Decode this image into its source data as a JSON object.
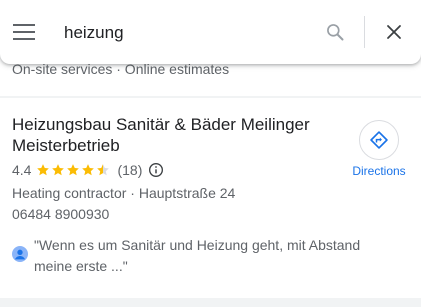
{
  "search": {
    "query": "heizung",
    "menu_icon": "menu-icon",
    "search_icon": "search-icon",
    "close_icon": "close-icon"
  },
  "previous_result": {
    "text": "On-site services · Online estimates"
  },
  "result": {
    "name": "Heizungsbau Sanitär & Bäder Meilinger Meisterbetrieb",
    "rating": 4.4,
    "rating_text": "4.4",
    "review_count": "(18)",
    "category_address": "Heating contractor · Hauptstraße 24",
    "phone": "06484 8900930",
    "directions_label": "Directions",
    "review_snippet": "\"Wenn es um Sanitär und Heizung geht, mit Abstand meine erste ...\""
  },
  "colors": {
    "accent": "#1a73e8",
    "star": "#fbbc04",
    "secondary_text": "#5f6368",
    "avatar": "#8ab4f8"
  }
}
